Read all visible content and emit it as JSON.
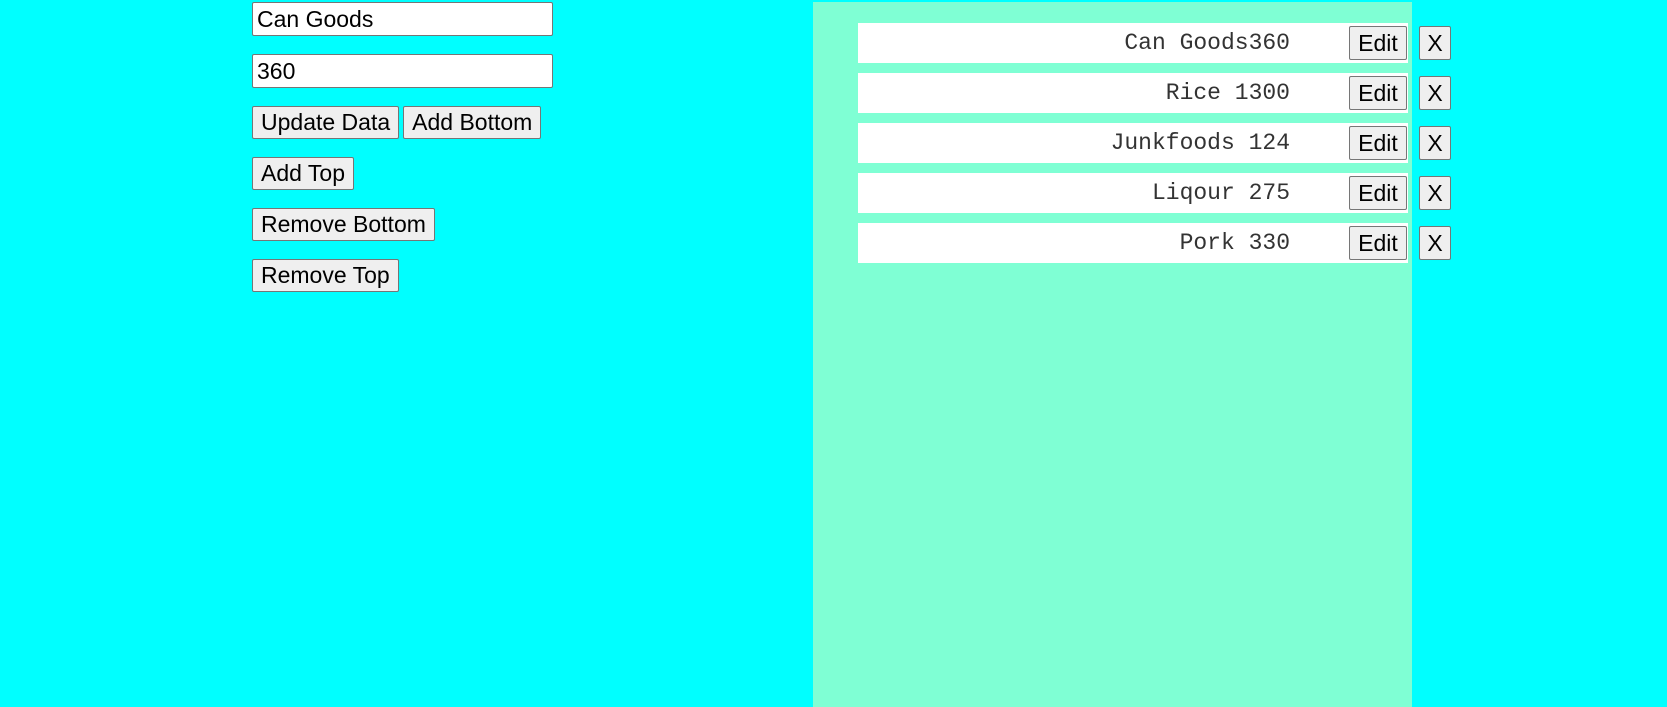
{
  "form": {
    "name_value": "Can Goods",
    "amount_value": "360",
    "update_label": "Update Data",
    "add_bottom_label": "Add Bottom",
    "add_top_label": "Add Top",
    "remove_bottom_label": "Remove Bottom",
    "remove_top_label": "Remove Top"
  },
  "list": {
    "items": [
      {
        "text": "Can Goods360",
        "edit_label": "Edit",
        "remove_label": "X"
      },
      {
        "text": "Rice 1300",
        "edit_label": "Edit",
        "remove_label": "X"
      },
      {
        "text": "Junkfoods 124",
        "edit_label": "Edit",
        "remove_label": "X"
      },
      {
        "text": "Liqour 275",
        "edit_label": "Edit",
        "remove_label": "X"
      },
      {
        "text": "Pork 330",
        "edit_label": "Edit",
        "remove_label": "X"
      }
    ]
  },
  "colors": {
    "page_background": "#00ffff",
    "list_background": "#7fffd4",
    "item_background": "#ffffff"
  }
}
